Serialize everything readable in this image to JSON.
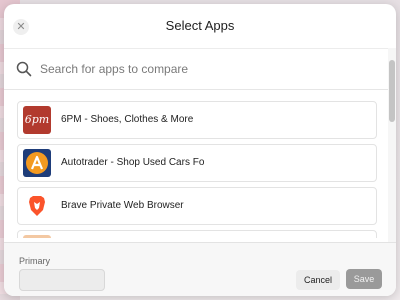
{
  "dialog": {
    "title": "Select Apps",
    "close_icon": "close-icon"
  },
  "search": {
    "placeholder": "Search for apps to compare",
    "value": "",
    "icon": "search-icon"
  },
  "apps": [
    {
      "name": "6PM - Shoes, Clothes & More",
      "logo": "6pm",
      "brand_color": "#b23a2e"
    },
    {
      "name": "Autotrader - Shop Used Cars Fo",
      "logo": "autotrader",
      "brand_color": "#1e3d7a"
    },
    {
      "name": "Brave Private Web Browser",
      "logo": "brave",
      "brand_color": "#fb542b"
    },
    {
      "name": "",
      "logo": "partial",
      "brand_color": "#f3c8a2"
    }
  ],
  "footer": {
    "primary_label": "Primary",
    "primary_value": "",
    "cancel_label": "Cancel",
    "save_label": "Save"
  },
  "colors": {
    "save_disabled": "#9a9a9a",
    "cancel_bg": "#ececec"
  }
}
